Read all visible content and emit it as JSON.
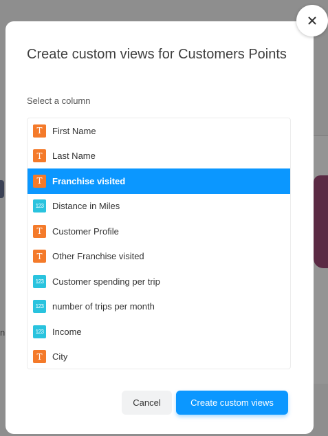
{
  "dialog": {
    "title": "Create custom views for Customers Points",
    "subtitle": "Select a column",
    "cancel_label": "Cancel",
    "create_label": "Create custom views",
    "close_icon": "close-icon",
    "accent_color": "#0b97ff"
  },
  "columns": [
    {
      "label": "First Name",
      "type": "text",
      "icon_glyph": "T",
      "selected": false
    },
    {
      "label": "Last Name",
      "type": "text",
      "icon_glyph": "T",
      "selected": false
    },
    {
      "label": "Franchise visited",
      "type": "text",
      "icon_glyph": "T",
      "selected": true
    },
    {
      "label": "Distance in Miles",
      "type": "number",
      "icon_glyph": "123",
      "selected": false
    },
    {
      "label": "Customer Profile",
      "type": "text",
      "icon_glyph": "T",
      "selected": false
    },
    {
      "label": "Other Franchise visited",
      "type": "text",
      "icon_glyph": "T",
      "selected": false
    },
    {
      "label": "Customer spending per trip",
      "type": "number",
      "icon_glyph": "123",
      "selected": false
    },
    {
      "label": "number of trips per month",
      "type": "number",
      "icon_glyph": "123",
      "selected": false
    },
    {
      "label": "Income",
      "type": "number",
      "icon_glyph": "123",
      "selected": false
    },
    {
      "label": "City",
      "type": "text",
      "icon_glyph": "T",
      "selected": false
    }
  ],
  "background": {
    "partial_letter": "n"
  }
}
